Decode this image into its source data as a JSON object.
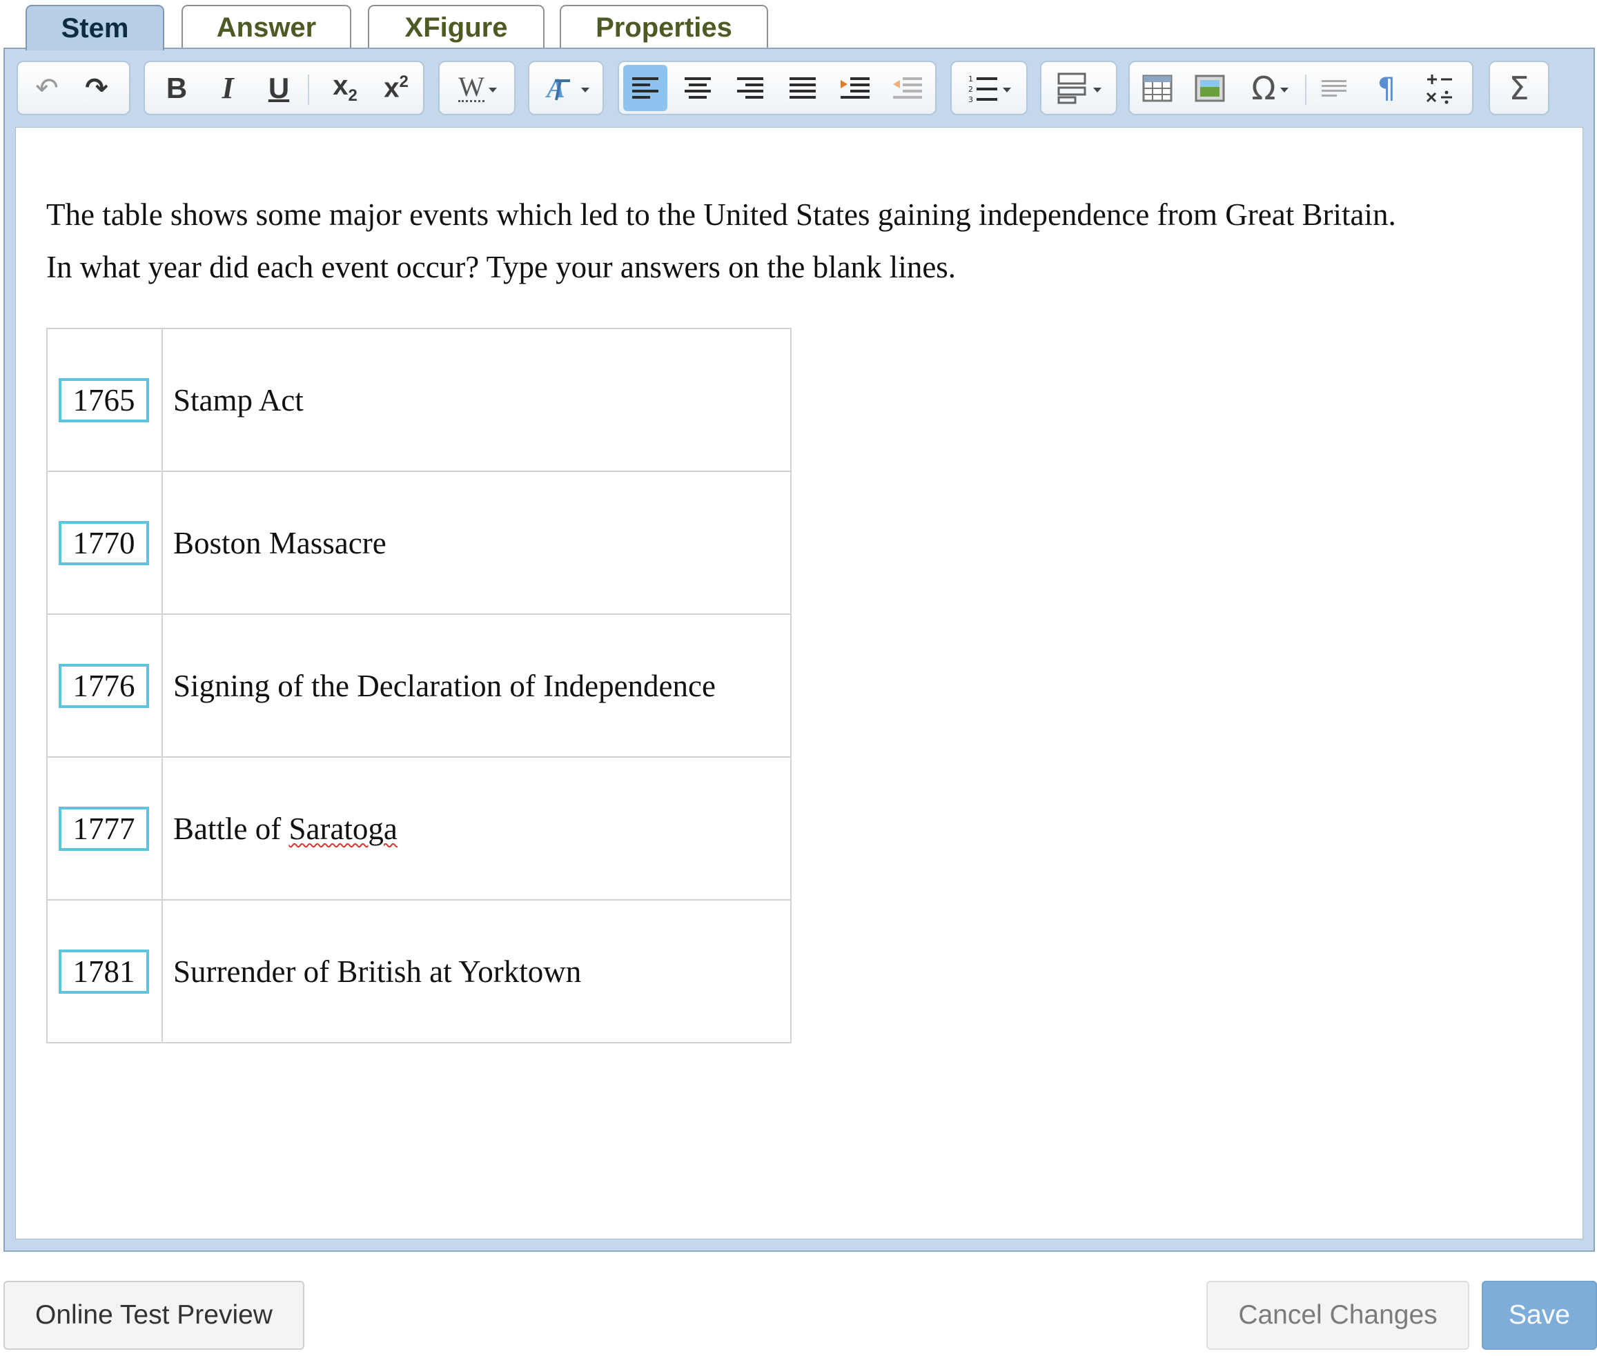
{
  "tabs": [
    {
      "label": "Stem",
      "active": true
    },
    {
      "label": "Answer",
      "active": false
    },
    {
      "label": "XFigure",
      "active": false
    },
    {
      "label": "Properties",
      "active": false
    }
  ],
  "toolbar": {
    "undo": "↶",
    "redo": "↷",
    "bold": "B",
    "italic": "I",
    "underline": "U",
    "subscript_base": "x",
    "subscript_mark": "2",
    "superscript_base": "x",
    "superscript_mark": "2",
    "word_style": "W",
    "special_char": "Ω",
    "paragraph_mark": "¶",
    "sigma": "Σ",
    "icons": [
      "undo-icon",
      "redo-icon",
      "bold-icon",
      "italic-icon",
      "underline-icon",
      "subscript-icon",
      "superscript-icon",
      "word-style-icon",
      "text-color-icon",
      "align-left-icon",
      "align-center-icon",
      "align-right-icon",
      "justify-icon",
      "indent-icon",
      "outdent-icon",
      "numbered-list-icon",
      "insert-layout-icon",
      "table-icon",
      "image-icon",
      "omega-icon",
      "text-block-icon",
      "pilcrow-icon",
      "math-operators-icon",
      "sigma-icon"
    ]
  },
  "stem": {
    "line1": "The table shows some major events which led to the United States gaining independence from Great Britain.",
    "line2": "In what year did each event occur? Type your answers on the blank lines."
  },
  "events": [
    {
      "year": "1765",
      "event": "Stamp Act"
    },
    {
      "year": "1770",
      "event": "Boston Massacre"
    },
    {
      "year": "1776",
      "event": "Signing of the Declaration of Independence"
    },
    {
      "year": "1777",
      "event_prefix": "Battle of ",
      "event_misspelled": "Saratoga"
    },
    {
      "year": "1781",
      "event": "Surrender of British at Yorktown"
    }
  ],
  "buttons": {
    "preview": "Online Test Preview",
    "cancel": "Cancel Changes",
    "save": "Save"
  },
  "colors": {
    "active_tab": "#b7cfe6",
    "editor_frame": "#c5d8eb",
    "answer_box_border": "#5ec4de",
    "save_button": "#7fadd9",
    "active_align": "#8ec3ef"
  }
}
